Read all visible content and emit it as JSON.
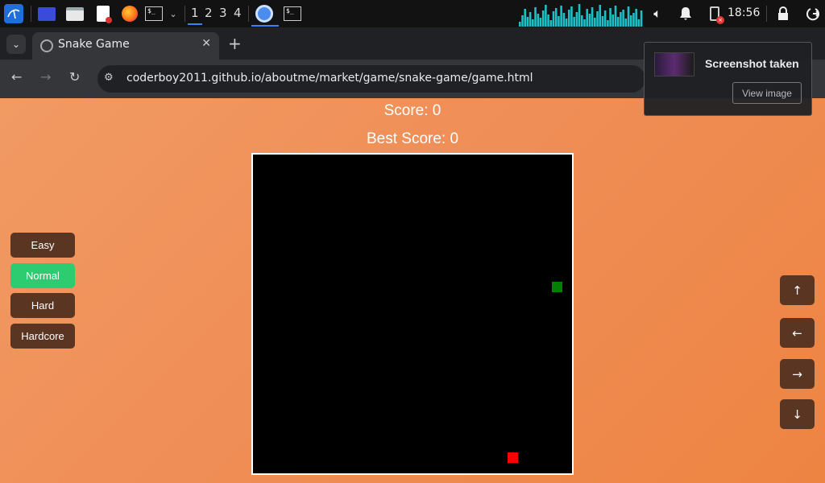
{
  "taskbar": {
    "workspaces": [
      "1",
      "2",
      "3",
      "4"
    ],
    "active_workspace": "1",
    "clock": "18:56",
    "icons": [
      "kali-menu-icon",
      "show-desktop-icon",
      "file-manager-icon",
      "text-editor-icon",
      "firefox-icon",
      "terminal-icon",
      "chromium-icon",
      "terminal-icon"
    ]
  },
  "browser": {
    "tab_title": "Snake Game",
    "new_tab": "+",
    "url": "coderboy2011.github.io/aboutme/market/game/snake-game/game.html"
  },
  "notification": {
    "title": "Screenshot taken",
    "button": "View image"
  },
  "game": {
    "score_label": "Score: 0",
    "best_label": "Best Score: 0",
    "difficulty": [
      "Easy",
      "Normal",
      "Hard",
      "Hardcore"
    ],
    "selected_difficulty": "Normal",
    "arrows": {
      "up": "↑",
      "left": "←",
      "right": "→",
      "down": "↓"
    },
    "colors": {
      "food": "#ff0000",
      "snake": "#008000",
      "board": "#000000",
      "selected": "#2ecc71",
      "button": "#5a3522"
    }
  }
}
